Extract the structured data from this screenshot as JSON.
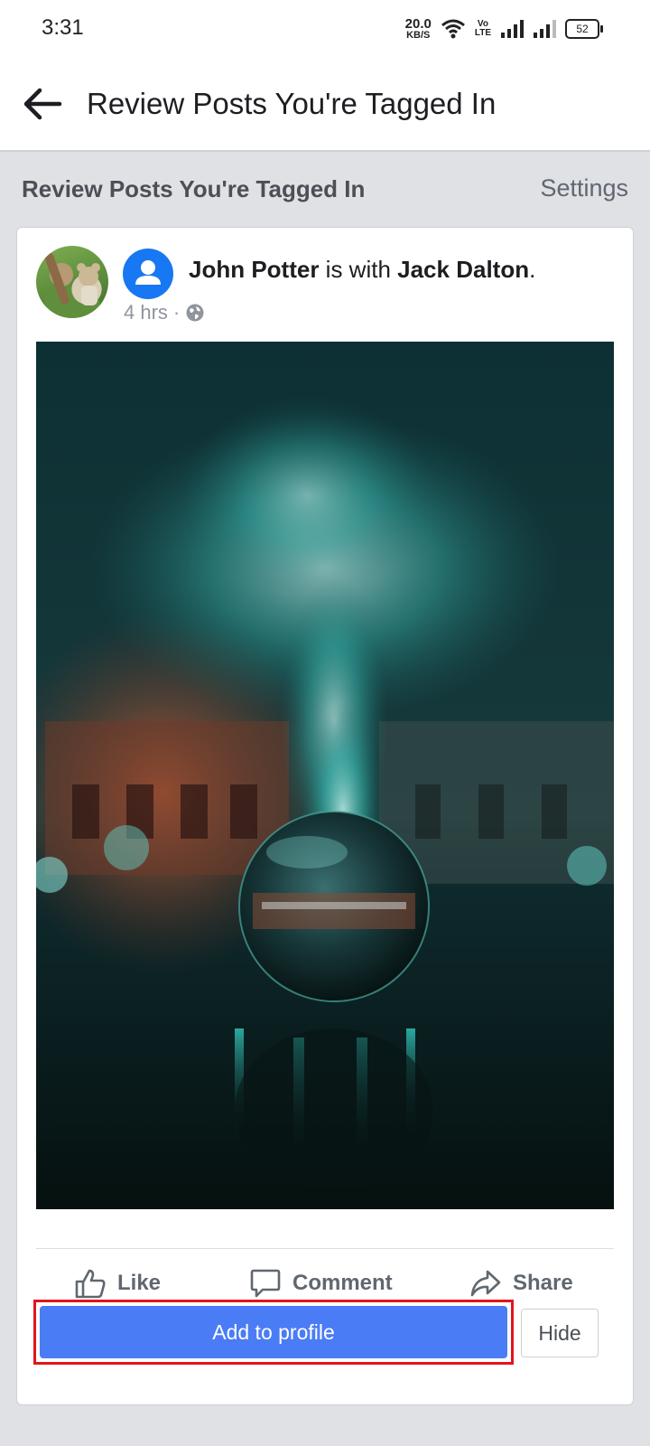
{
  "status_bar": {
    "time": "3:31",
    "net_speed_value": "20.0",
    "net_speed_unit": "KB/S",
    "volte_top": "Vo",
    "volte_bottom": "LTE",
    "battery": "52"
  },
  "header": {
    "title": "Review Posts You're Tagged In"
  },
  "section": {
    "title": "Review Posts You're Tagged In",
    "settings_label": "Settings"
  },
  "post": {
    "author": "John Potter",
    "with_text": " is with ",
    "tagged": "Jack Dalton",
    "end_punct": ".",
    "time": "4 hrs",
    "separator": " · ",
    "actions": {
      "like": "Like",
      "comment": "Comment",
      "share": "Share"
    },
    "add_to_profile": "Add to profile",
    "hide": "Hide"
  },
  "colors": {
    "brand_blue": "#1877f2",
    "button_blue": "#4a7cf5",
    "highlight_red": "#e0161c"
  }
}
